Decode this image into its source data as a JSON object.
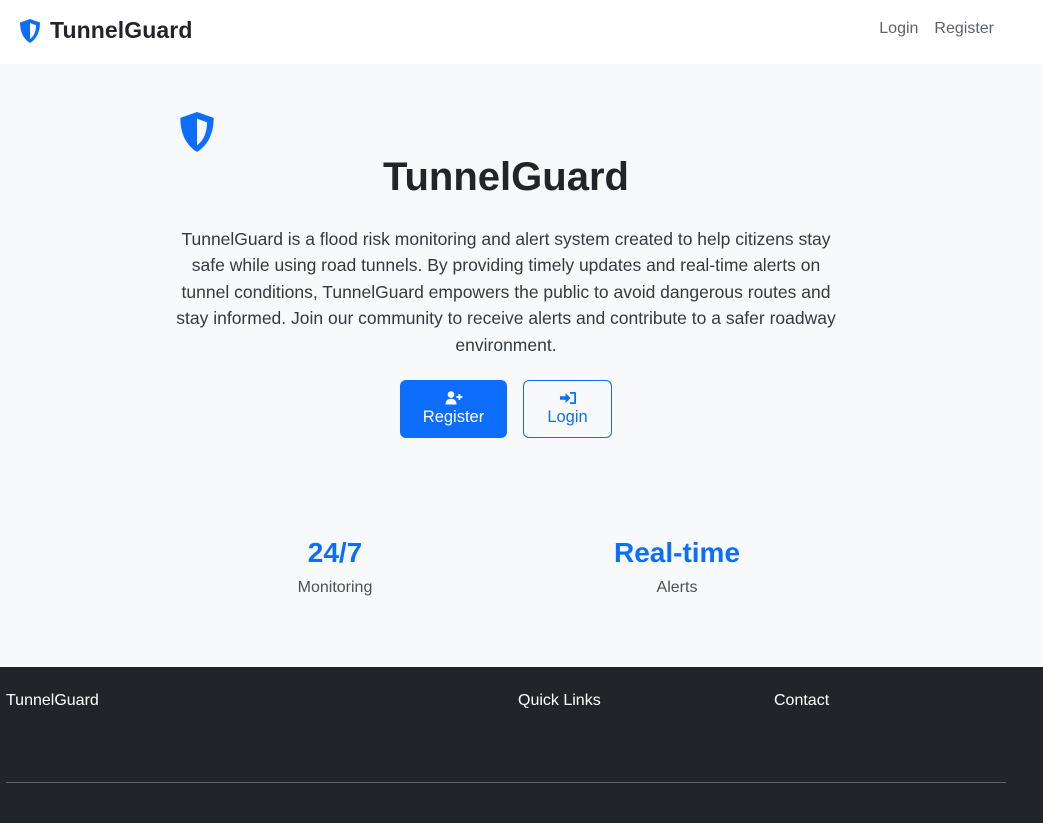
{
  "navbar": {
    "brand": "TunnelGuard",
    "brand_icon": "shield-icon",
    "links": [
      "Login",
      "Register"
    ]
  },
  "hero": {
    "icon": "shield-icon",
    "title": "TunnelGuard",
    "description": "TunnelGuard is a flood risk monitoring and alert system created to help citizens stay safe while using road tunnels. By providing timely updates and real-time alerts on tunnel conditions, TunnelGuard empowers the public to avoid dangerous routes and stay informed. Join our community to receive alerts and contribute to a safer roadway environment.",
    "buttons": {
      "register": {
        "label": "Register",
        "icon": "user-plus-icon"
      },
      "login": {
        "label": "Login",
        "icon": "sign-in-icon"
      }
    }
  },
  "stats": [
    {
      "value": "24/7",
      "label": "Monitoring"
    },
    {
      "value": "Real-time",
      "label": "Alerts"
    }
  ],
  "footer": {
    "columns": [
      "TunnelGuard",
      "Quick Links",
      "Contact"
    ]
  },
  "colors": {
    "primary": "#0d6efd",
    "footer_bg": "#212529",
    "page_bg": "#f8f9fa"
  }
}
